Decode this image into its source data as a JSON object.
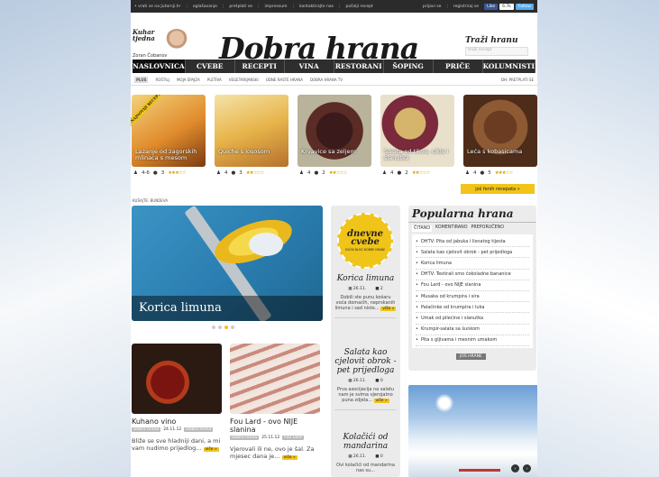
{
  "topbar": {
    "links": [
      "• vrati se na Jutarnji.hr",
      "oglašavanje",
      "pretplati se",
      "impressum",
      "kontaktirajte nas",
      "pošalji recept"
    ],
    "right_links": [
      "prijavi se",
      "registriraj se"
    ],
    "like_label": "Like",
    "like_count": "6.7k",
    "follow_label": "Follow"
  },
  "header": {
    "kuhar_title": "Kuhar tjedna",
    "kuhar_name": "Zoran Čobanov",
    "logo": "Dobra hrana",
    "search_title": "Traži hranu",
    "search_placeholder": "traži recept"
  },
  "nav": {
    "items": [
      "NASLOVNICA",
      "CVEBE",
      "RECEPTI",
      "VINA",
      "RESTORANI",
      "ŠOPING",
      "PRIČE",
      "KOLUMNISTI"
    ]
  },
  "subnav": {
    "plus": "PLUS",
    "items": [
      "ROŠTILJ",
      "MOJA ŠPAJZA",
      "PLETIVA",
      "VEGETARIJANSKI",
      "ODNE RASTE HRANA",
      "DOBRA HRANA TV"
    ],
    "right": "DH: PRETPLATI SE"
  },
  "ribbon": "NAJNOVIJI RECEPTI",
  "recipes": [
    {
      "title": "Lazanje od zagorskih mlinaca s mesom",
      "servings": "4-6",
      "time": "3",
      "rating": "★★★☆☆"
    },
    {
      "title": "Quiche s lososom",
      "servings": "4",
      "time": "3",
      "rating": "★★☆☆☆"
    },
    {
      "title": "Krvavice sa zeljem",
      "servings": "4",
      "time": "2",
      "rating": "★★☆☆☆"
    },
    {
      "title": "Salata od tikve, cikle i slanutka",
      "servings": "4",
      "time": "2",
      "rating": "★★☆☆☆"
    },
    {
      "title": "Leća s kobasicama",
      "servings": "4",
      "time": "5",
      "rating": "★★★☆☆"
    }
  ],
  "more_button": "još fenih recepata »",
  "breadcrumb": "KUŠAJTE: BUNDEVA",
  "feature": {
    "caption": "Korica limuna"
  },
  "daily": {
    "badge_title": "dnevne cvebe",
    "badge_sub": "SOČNI BLOG DOBRE HRANE",
    "items": [
      {
        "title": "Korica limuna",
        "date": "26.11.",
        "comments": "2",
        "text": "Dobili ste punu košaru voća domaćih, neprskanih limuna i sad niste..."
      },
      {
        "title": "Salata kao cjelovit obrok - pet prijedloga",
        "date": "26.11.",
        "comments": "0",
        "text": "Prva asocijacija na salatu nam je svima vjerojatno puna zdjela..."
      },
      {
        "title": "Kolačići od mandarina",
        "date": "26.11.",
        "comments": "0",
        "text": "Ovi kolačići od mandarina nas su..."
      }
    ],
    "more": "više »"
  },
  "cards": [
    {
      "title": "Kuhano vino",
      "tag1": "Dobra hrana",
      "date": "24.11.12",
      "tag2": "Dobra hrana",
      "text": "Bliže se sve hladniji dani, a mi vam nudimo prijedlog...",
      "more": "više »"
    },
    {
      "title": "Fou Lard - ovo NIJE slanina",
      "tag1": "Dobra hrana",
      "date": "25.11.12",
      "tag2": "Fou Lard",
      "text": "Vjerovali ili ne, ovo je šal. Za mjesec dana je...",
      "more": "više »"
    }
  ],
  "popular": {
    "title": "Popularna hrana",
    "tabs": [
      "ČITANO",
      "KOMENTIRANO",
      "PREPORUČENO"
    ],
    "items": [
      "DHTV: Pita od jabuka i lisnatog tijesta",
      "Salata kao cjelovit obrok - pet prijedloga",
      "Korica limuna",
      "DHTV: Testirali smo čokoladne bananice",
      "Fou Lard - ovo NIJE slanina",
      "Musaka od krumpira i sira",
      "Palačinke od krumpira i luka",
      "Umak od pilećine i slanutka",
      "Krumpir-salata sa šunkom",
      "Pita s gljivama i mesnim umakom"
    ],
    "button": "JOŠ HRANE"
  },
  "ad": {
    "prev": "‹",
    "next": "›"
  }
}
